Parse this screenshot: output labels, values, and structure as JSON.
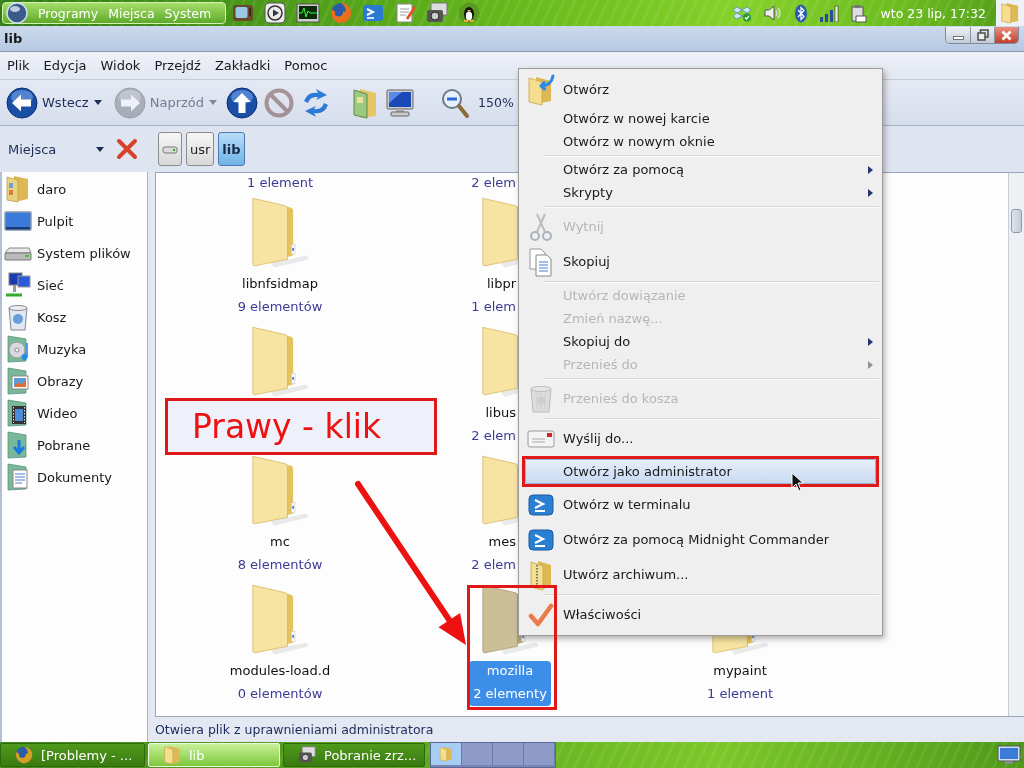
{
  "top_panel": {
    "menus": [
      "Programy",
      "Miejsca",
      "System"
    ],
    "clock": "wto 23 lip, 17:32"
  },
  "window": {
    "title": "lib"
  },
  "menubar": [
    "Plik",
    "Edycja",
    "Widok",
    "Przejdź",
    "Zakładki",
    "Pomoc"
  ],
  "toolbar": {
    "buttons": [
      {
        "kind": "back",
        "label": "Wstecz",
        "disabled": false,
        "dropdown": true
      },
      {
        "kind": "forward",
        "label": "Naprzód",
        "disabled": true,
        "dropdown": true
      },
      {
        "kind": "up",
        "disabled": false
      },
      {
        "kind": "stop",
        "disabled": true
      },
      {
        "kind": "reload",
        "disabled": false
      },
      {
        "kind": "home",
        "disabled": false
      },
      {
        "kind": "computer",
        "disabled": false
      },
      {
        "kind": "zoom-out",
        "disabled": false
      }
    ],
    "zoom": "150%"
  },
  "location_bar": {
    "places": "Miejsca",
    "path": [
      {
        "kind": "drive",
        "selected": false
      },
      {
        "kind": "folder",
        "label": "usr",
        "selected": false
      },
      {
        "kind": "folder",
        "label": "lib",
        "selected": true
      }
    ]
  },
  "sidebar": {
    "items": [
      {
        "kind": "home",
        "label": "daro"
      },
      {
        "kind": "desktop",
        "label": "Pulpit"
      },
      {
        "kind": "drive",
        "label": "System plików"
      },
      {
        "kind": "network",
        "label": "Sieć"
      },
      {
        "kind": "trash",
        "label": "Kosz"
      },
      {
        "kind": "music",
        "label": "Muzyka"
      },
      {
        "kind": "pictures",
        "label": "Obrazy"
      },
      {
        "kind": "video",
        "label": "Wideo"
      },
      {
        "kind": "downloads",
        "label": "Pobrane"
      },
      {
        "kind": "documents",
        "label": "Dokumenty"
      }
    ]
  },
  "files": {
    "top_counts": [
      "1 element",
      "2 elem"
    ],
    "rows": [
      [
        {
          "name": "libnfsidmap",
          "count": "9 elementów",
          "selected": false
        },
        {
          "name": "libpr",
          "count": "1 elem",
          "selected": false
        }
      ],
      [
        {
          "selected": false
        },
        {
          "name": "libus",
          "count": "2 elem",
          "selected": false
        }
      ],
      [
        {
          "name": "mc",
          "count": "8 elementów",
          "selected": false
        },
        {
          "name": "mes",
          "count": "2 elem",
          "selected": false
        }
      ],
      [
        {
          "name": "modules-load.d",
          "count": "0 elementów",
          "selected": false
        },
        {
          "name": "mozilla",
          "count": "2 elementy",
          "selected": true
        },
        {
          "name": "mypaint",
          "count": "1 element",
          "selected": false
        }
      ]
    ]
  },
  "context_menu": {
    "groups": [
      [
        {
          "kind": "open",
          "label": "Otwórz",
          "disabled": false,
          "selected": false,
          "submenu": false
        },
        {
          "kind": "plain",
          "label": "Otwórz w nowej karcie",
          "disabled": false,
          "selected": false,
          "submenu": false
        },
        {
          "kind": "plain",
          "label": "Otwórz w nowym oknie",
          "disabled": false,
          "selected": false,
          "submenu": false
        }
      ],
      [
        {
          "kind": "plain",
          "label": "Otwórz za pomocą",
          "disabled": false,
          "selected": false,
          "submenu": true
        },
        {
          "kind": "plain",
          "label": "Skrypty",
          "disabled": false,
          "selected": false,
          "submenu": true
        }
      ],
      [
        {
          "kind": "cut",
          "label": "Wytnij",
          "disabled": true,
          "selected": false,
          "submenu": false
        },
        {
          "kind": "copy",
          "label": "Skopiuj",
          "disabled": false,
          "selected": false,
          "submenu": false
        }
      ],
      [
        {
          "kind": "plain",
          "label": "Utwórz dowiązanie",
          "disabled": true,
          "selected": false,
          "submenu": false
        },
        {
          "kind": "plain",
          "label": "Zmień nazwę...",
          "disabled": true,
          "selected": false,
          "submenu": false
        },
        {
          "kind": "plain",
          "label": "Skopiuj do",
          "disabled": false,
          "selected": false,
          "submenu": true
        },
        {
          "kind": "plain",
          "label": "Przenieś do",
          "disabled": true,
          "selected": false,
          "submenu": true
        }
      ],
      [
        {
          "kind": "trash",
          "label": "Przenieś do kosza",
          "disabled": true,
          "selected": false,
          "submenu": false
        }
      ],
      [
        {
          "kind": "send",
          "label": "Wyślij do...",
          "disabled": false,
          "selected": false,
          "submenu": false
        },
        {
          "kind": "plain",
          "label": "Otwórz jako administrator",
          "disabled": false,
          "selected": true,
          "submenu": false
        },
        {
          "kind": "terminal",
          "label": "Otwórz w terminalu",
          "disabled": false,
          "selected": false,
          "submenu": false
        },
        {
          "kind": "terminal",
          "label": "Otwórz za pomocą Midnight Commander",
          "disabled": false,
          "selected": false,
          "submenu": false
        },
        {
          "kind": "archive",
          "label": "Utwórz archiwum...",
          "disabled": false,
          "selected": false,
          "submenu": false
        }
      ],
      [
        {
          "kind": "properties",
          "label": "Właściwości",
          "disabled": false,
          "selected": false,
          "submenu": false
        }
      ]
    ]
  },
  "status_bar": "Otwiera plik z uprawnieniami administratora",
  "taskbar": {
    "tasks": [
      {
        "kind": "browser",
        "label": "[Problemy - ...",
        "selected": false
      },
      {
        "kind": "folder",
        "label": "lib",
        "selected": true
      },
      {
        "kind": "screenshot",
        "label": "Pobranie zrz...",
        "selected": false
      }
    ],
    "workspaces": [
      {
        "selected": true
      },
      {
        "selected": false
      },
      {
        "selected": false
      },
      {
        "selected": false
      }
    ]
  },
  "annotation": {
    "callout": "Prawy - klik"
  }
}
